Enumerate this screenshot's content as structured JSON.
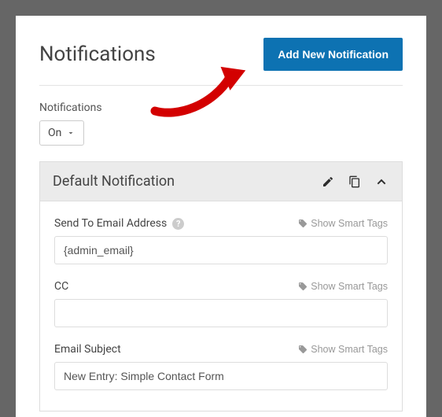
{
  "header": {
    "title": "Notifications",
    "add_button": "Add New Notification"
  },
  "toggle": {
    "label": "Notifications",
    "value": "On"
  },
  "notification": {
    "title": "Default Notification",
    "smart_tags_label": "Show Smart Tags",
    "fields": {
      "send_to": {
        "label": "Send To Email Address",
        "value": "{admin_email}"
      },
      "cc": {
        "label": "CC",
        "value": ""
      },
      "subject": {
        "label": "Email Subject",
        "value": "New Entry: Simple Contact Form"
      }
    }
  },
  "icons": {
    "edit": "edit-icon",
    "copy": "copy-icon",
    "collapse": "chevron-up-icon",
    "tag": "tag-icon",
    "help": "?"
  }
}
